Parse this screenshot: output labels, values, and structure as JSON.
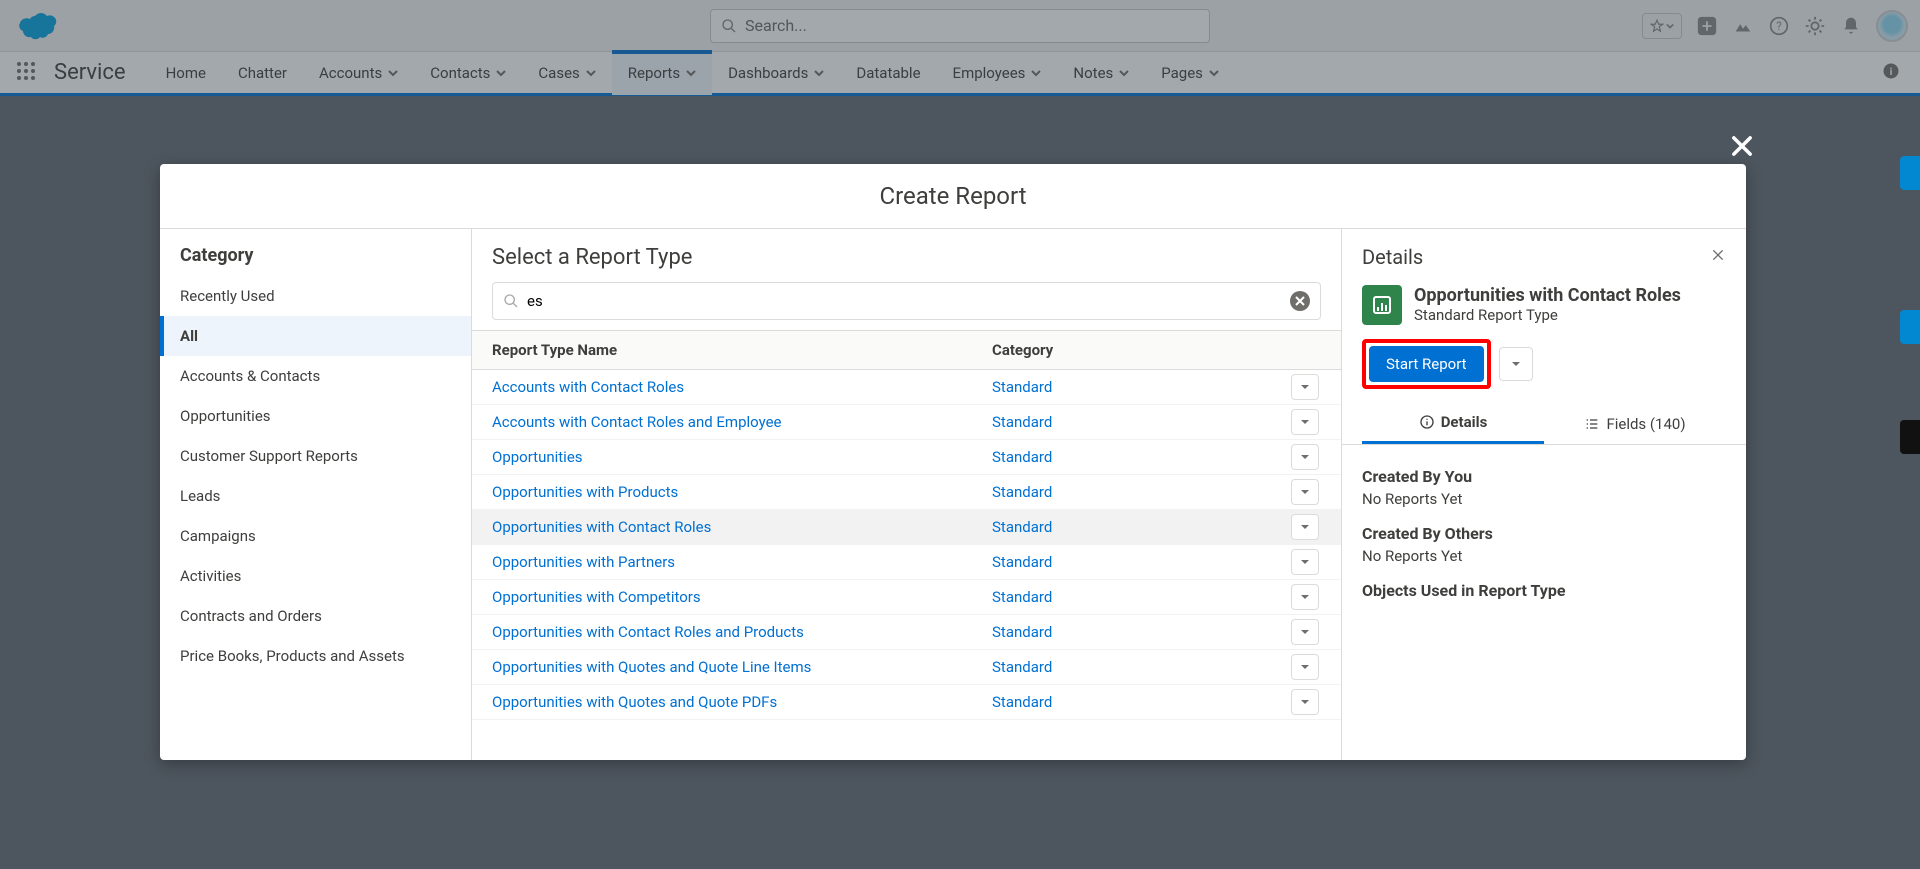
{
  "header": {
    "search_placeholder": "Search..."
  },
  "nav": {
    "app_name": "Service",
    "items": [
      "Home",
      "Chatter",
      "Accounts",
      "Contacts",
      "Cases",
      "Reports",
      "Dashboards",
      "Datatable",
      "Employees",
      "Notes",
      "Pages"
    ],
    "with_menu": [
      false,
      false,
      true,
      true,
      true,
      true,
      true,
      false,
      true,
      true,
      true
    ],
    "active_index": 5
  },
  "modal": {
    "title": "Create Report",
    "category_header": "Category",
    "categories": [
      "Recently Used",
      "All",
      "Accounts & Contacts",
      "Opportunities",
      "Customer Support Reports",
      "Leads",
      "Campaigns",
      "Activities",
      "Contracts and Orders",
      "Price Books, Products and Assets"
    ],
    "active_category_index": 1,
    "types_header": "Select a Report Type",
    "search_value": "es",
    "col_name": "Report Type Name",
    "col_cat": "Category",
    "types": [
      {
        "name": "Accounts with Contact Roles",
        "cat": "Standard"
      },
      {
        "name": "Accounts with Contact Roles and Employee",
        "cat": "Standard"
      },
      {
        "name": "Opportunities",
        "cat": "Standard"
      },
      {
        "name": "Opportunities with Products",
        "cat": "Standard"
      },
      {
        "name": "Opportunities with Contact Roles",
        "cat": "Standard"
      },
      {
        "name": "Opportunities with Partners",
        "cat": "Standard"
      },
      {
        "name": "Opportunities with Competitors",
        "cat": "Standard"
      },
      {
        "name": "Opportunities with Contact Roles and Products",
        "cat": "Standard"
      },
      {
        "name": "Opportunities with Quotes and Quote Line Items",
        "cat": "Standard"
      },
      {
        "name": "Opportunities with Quotes and Quote PDFs",
        "cat": "Standard"
      }
    ],
    "selected_type_index": 4
  },
  "details": {
    "header": "Details",
    "rt_name": "Opportunities with Contact Roles",
    "rt_type": "Standard Report Type",
    "start_label": "Start Report",
    "tab_details": "Details",
    "tab_fields": "Fields (140)",
    "created_by_you": "Created By You",
    "no_reports_yet": "No Reports Yet",
    "created_by_others": "Created By Others",
    "objects_used": "Objects Used in Report Type"
  }
}
